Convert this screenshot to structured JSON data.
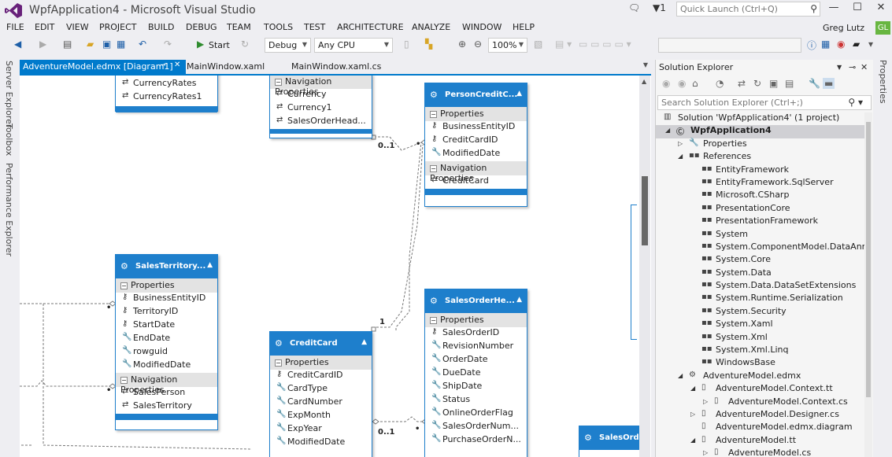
{
  "window": {
    "title": "WpfApplication4 - Microsoft Visual Studio",
    "notification_count": "1",
    "quick_launch_placeholder": "Quick Launch (Ctrl+Q)",
    "user_name": "Greg Lutz",
    "user_initials": "GL"
  },
  "menu": [
    "FILE",
    "EDIT",
    "VIEW",
    "PROJECT",
    "BUILD",
    "DEBUG",
    "TEAM",
    "TOOLS",
    "TEST",
    "ARCHITECTURE",
    "ANALYZE",
    "WINDOW",
    "HELP"
  ],
  "toolbar": {
    "start_label": "Start",
    "config": "Debug",
    "platform": "Any CPU",
    "zoom": "100%"
  },
  "left_rail": [
    "Server Explorer",
    "Toolbox",
    "Performance Explorer"
  ],
  "doc_tabs": [
    {
      "label": "AdventureModel.edmx [Diagram1]",
      "active": true
    },
    {
      "label": "MainWindow.xaml",
      "active": false
    },
    {
      "label": "MainWindow.xaml.cs",
      "active": false
    }
  ],
  "entities": {
    "currency_partial": {
      "props": [
        "CurrencyRates",
        "CurrencyRates1"
      ]
    },
    "nav_partial": {
      "section": "Navigation Properties",
      "props": [
        "Currency",
        "Currency1",
        "SalesOrderHead..."
      ]
    },
    "person_credit": {
      "title": "PersonCreditC...",
      "sections": [
        {
          "name": "Properties",
          "props": [
            "BusinessEntityID",
            "CreditCardID",
            "ModifiedDate"
          ]
        },
        {
          "name": "Navigation Properties",
          "props": [
            "CreditCard"
          ]
        }
      ]
    },
    "sales_territory": {
      "title": "SalesTerritory...",
      "sections": [
        {
          "name": "Properties",
          "props": [
            "BusinessEntityID",
            "TerritoryID",
            "StartDate",
            "EndDate",
            "rowguid",
            "ModifiedDate"
          ]
        },
        {
          "name": "Navigation Properties",
          "props": [
            "SalesPerson",
            "SalesTerritory"
          ]
        }
      ]
    },
    "credit_card": {
      "title": "CreditCard",
      "sections": [
        {
          "name": "Properties",
          "props": [
            "CreditCardID",
            "CardType",
            "CardNumber",
            "ExpMonth",
            "ExpYear",
            "ModifiedDate"
          ]
        }
      ]
    },
    "sales_order_header": {
      "title": "SalesOrderHe...",
      "sections": [
        {
          "name": "Properties",
          "props": [
            "SalesOrderID",
            "RevisionNumber",
            "OrderDate",
            "DueDate",
            "ShipDate",
            "Status",
            "OnlineOrderFlag",
            "SalesOrderNum...",
            "PurchaseOrderN..."
          ]
        }
      ]
    },
    "sales_order_partial": {
      "title": "SalesOrde..."
    }
  },
  "labels": {
    "l1": "0..1",
    "l2": "1",
    "l3": "0..1"
  },
  "solution_explorer": {
    "title": "Solution Explorer",
    "search_placeholder": "Search Solution Explorer (Ctrl+;)",
    "tree": [
      {
        "label": "Solution 'WpfApplication4' (1 project)",
        "indent": 0,
        "expander": "",
        "icon": "solution-icon",
        "selected": false
      },
      {
        "label": "WpfApplication4",
        "indent": 1,
        "expander": "◢",
        "icon": "csharp-project-icon",
        "selected": true
      },
      {
        "label": "Properties",
        "indent": 2,
        "expander": "▷",
        "icon": "wrench-icon",
        "selected": false
      },
      {
        "label": "References",
        "indent": 2,
        "expander": "◢",
        "icon": "references-icon",
        "selected": false
      },
      {
        "label": "EntityFramework",
        "indent": 3,
        "expander": "",
        "icon": "reference-icon",
        "selected": false
      },
      {
        "label": "EntityFramework.SqlServer",
        "indent": 3,
        "expander": "",
        "icon": "reference-icon",
        "selected": false
      },
      {
        "label": "Microsoft.CSharp",
        "indent": 3,
        "expander": "",
        "icon": "reference-icon",
        "selected": false
      },
      {
        "label": "PresentationCore",
        "indent": 3,
        "expander": "",
        "icon": "reference-icon",
        "selected": false
      },
      {
        "label": "PresentationFramework",
        "indent": 3,
        "expander": "",
        "icon": "reference-icon",
        "selected": false
      },
      {
        "label": "System",
        "indent": 3,
        "expander": "",
        "icon": "reference-icon",
        "selected": false
      },
      {
        "label": "System.ComponentModel.DataAnnot",
        "indent": 3,
        "expander": "",
        "icon": "reference-icon",
        "selected": false
      },
      {
        "label": "System.Core",
        "indent": 3,
        "expander": "",
        "icon": "reference-icon",
        "selected": false
      },
      {
        "label": "System.Data",
        "indent": 3,
        "expander": "",
        "icon": "reference-icon",
        "selected": false
      },
      {
        "label": "System.Data.DataSetExtensions",
        "indent": 3,
        "expander": "",
        "icon": "reference-icon",
        "selected": false
      },
      {
        "label": "System.Runtime.Serialization",
        "indent": 3,
        "expander": "",
        "icon": "reference-icon",
        "selected": false
      },
      {
        "label": "System.Security",
        "indent": 3,
        "expander": "",
        "icon": "reference-icon",
        "selected": false
      },
      {
        "label": "System.Xaml",
        "indent": 3,
        "expander": "",
        "icon": "reference-icon",
        "selected": false
      },
      {
        "label": "System.Xml",
        "indent": 3,
        "expander": "",
        "icon": "reference-icon",
        "selected": false
      },
      {
        "label": "System.Xml.Linq",
        "indent": 3,
        "expander": "",
        "icon": "reference-icon",
        "selected": false
      },
      {
        "label": "WindowsBase",
        "indent": 3,
        "expander": "",
        "icon": "reference-icon",
        "selected": false
      },
      {
        "label": "AdventureModel.edmx",
        "indent": 2,
        "expander": "◢",
        "icon": "edmx-icon",
        "selected": false
      },
      {
        "label": "AdventureModel.Context.tt",
        "indent": 3,
        "expander": "◢",
        "icon": "tt-file-icon",
        "selected": false
      },
      {
        "label": "AdventureModel.Context.cs",
        "indent": 4,
        "expander": "▷",
        "icon": "cs-file-icon",
        "selected": false
      },
      {
        "label": "AdventureModel.Designer.cs",
        "indent": 3,
        "expander": "▷",
        "icon": "cs-file-icon",
        "selected": false
      },
      {
        "label": "AdventureModel.edmx.diagram",
        "indent": 3,
        "expander": "",
        "icon": "diagram-file-icon",
        "selected": false
      },
      {
        "label": "AdventureModel.tt",
        "indent": 3,
        "expander": "◢",
        "icon": "tt-file-icon",
        "selected": false
      },
      {
        "label": "AdventureModel.cs",
        "indent": 4,
        "expander": "▷",
        "icon": "cs-file-icon",
        "selected": false
      }
    ]
  },
  "right_rail": {
    "properties_label": "Properties"
  },
  "colors": {
    "accent": "#007acc",
    "entity": "#1e7fcc",
    "avatar": "#68b641"
  }
}
